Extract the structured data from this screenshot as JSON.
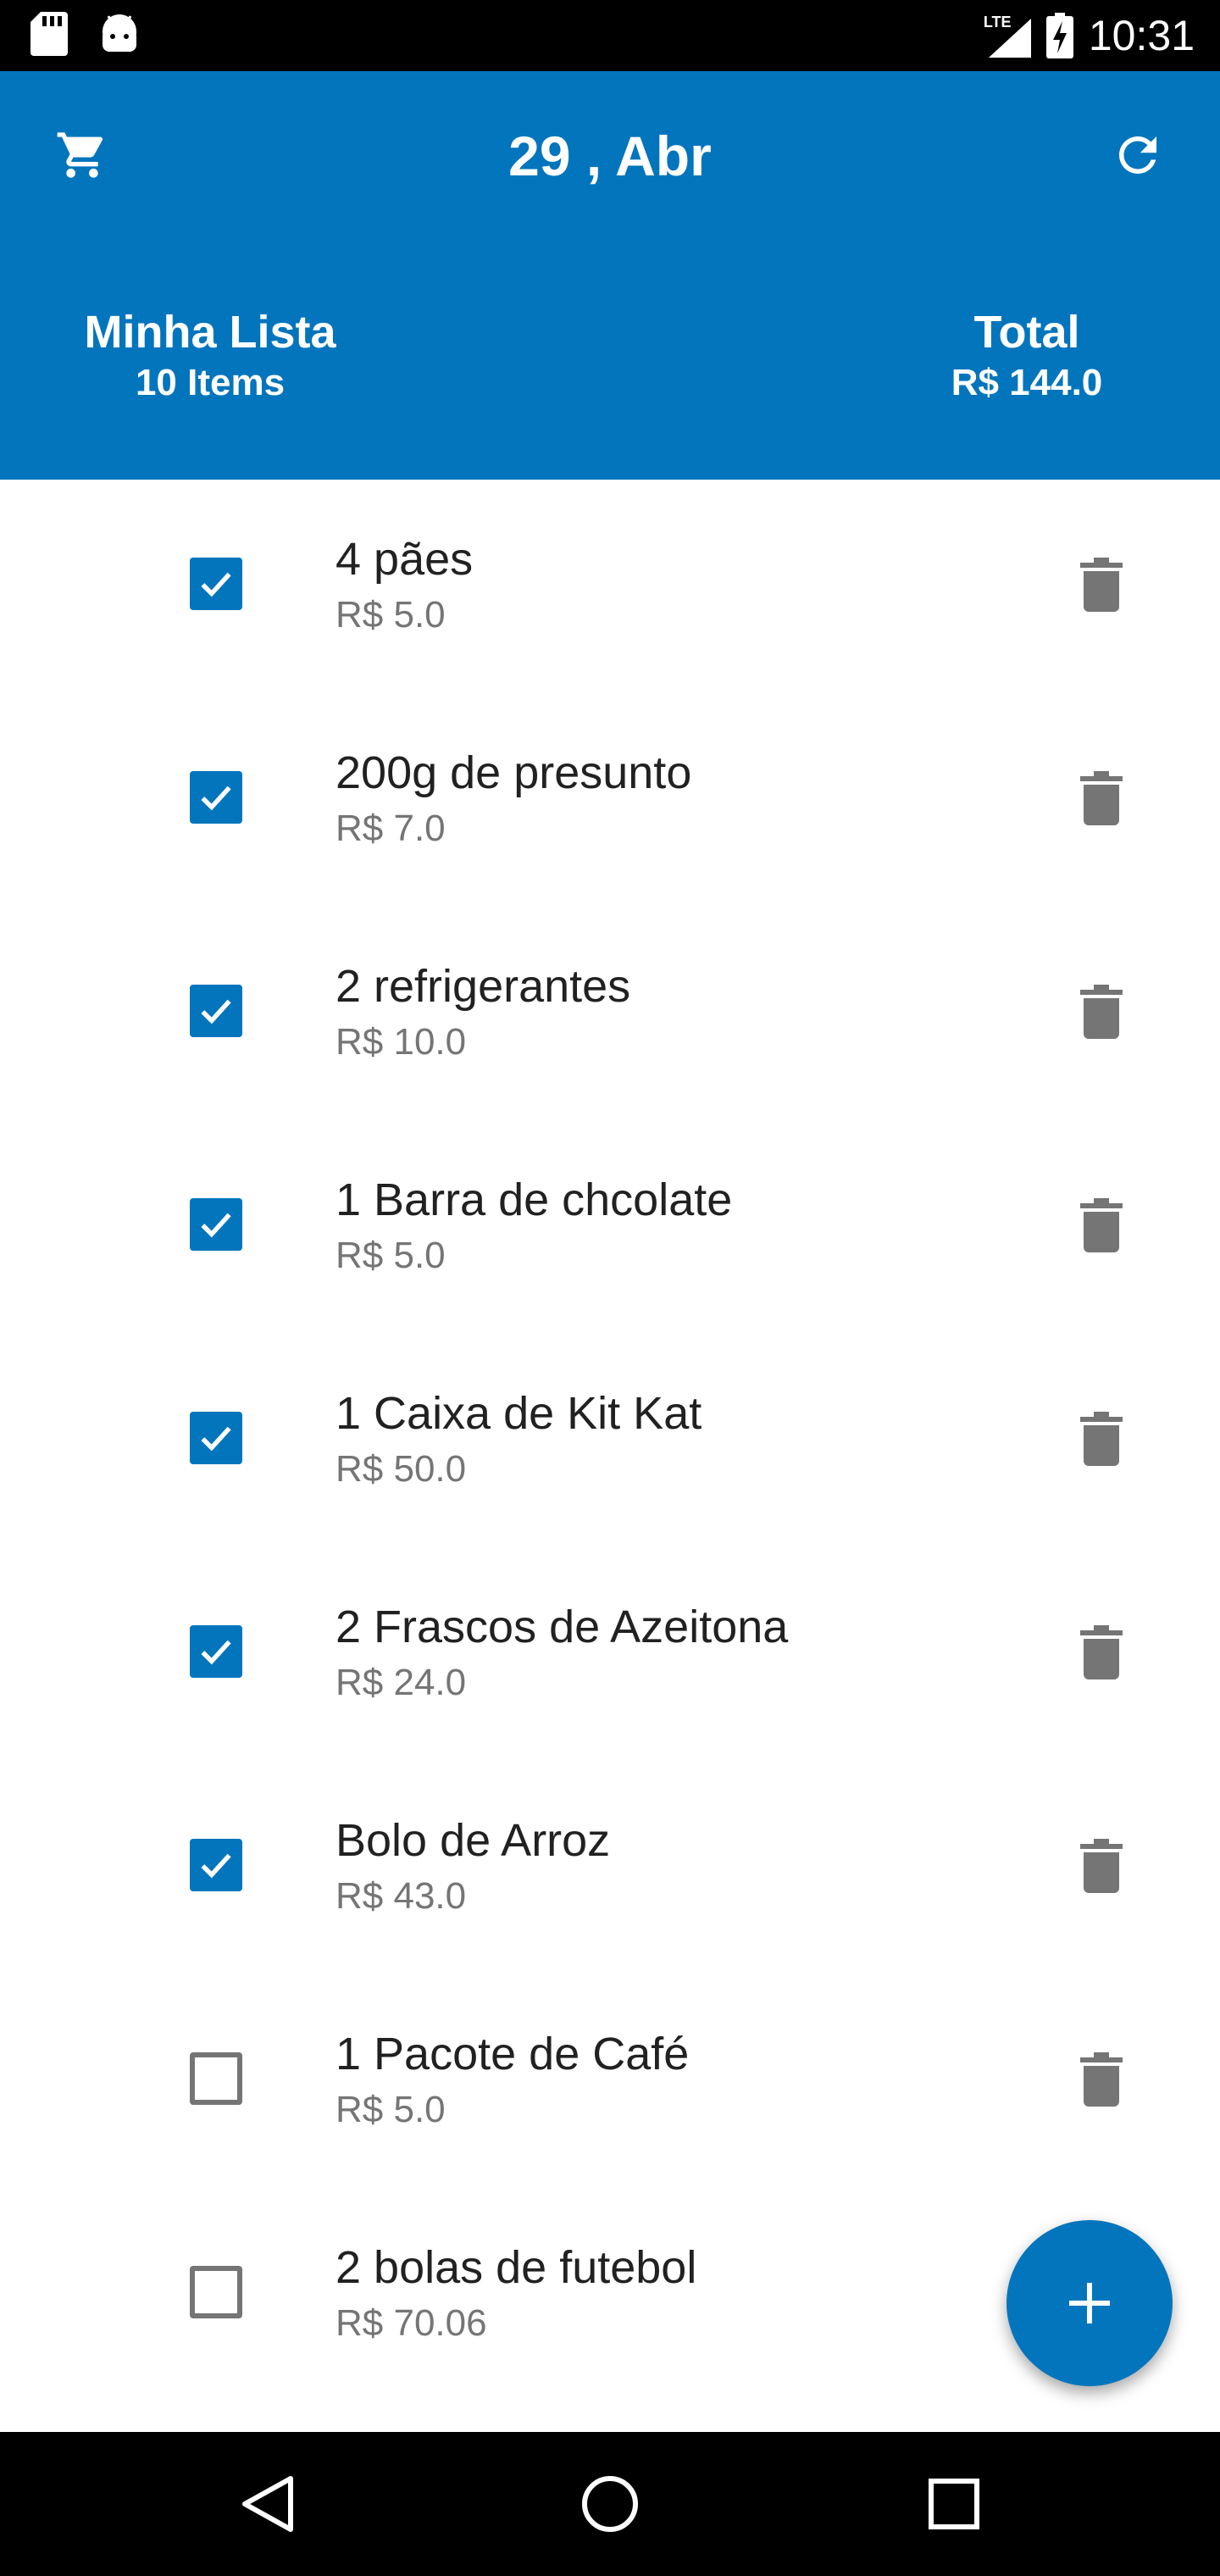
{
  "status_bar": {
    "network": "LTE",
    "time": "10:31"
  },
  "app_bar": {
    "title": "29 , Abr",
    "left_icon": "cart-icon",
    "right_icon": "refresh-icon",
    "color": "#0375bd"
  },
  "summary": {
    "list_title": "Minha Lista",
    "list_count": "10 Items",
    "total_title": "Total",
    "total_value": "R$ 144.0"
  },
  "items": [
    {
      "name": "4 pães",
      "price": "R$ 5.0",
      "checked": true
    },
    {
      "name": "200g de presunto",
      "price": "R$ 7.0",
      "checked": true
    },
    {
      "name": "2 refrigerantes",
      "price": "R$ 10.0",
      "checked": true
    },
    {
      "name": "1 Barra de chcolate",
      "price": "R$ 5.0",
      "checked": true
    },
    {
      "name": "1 Caixa de Kit Kat",
      "price": "R$ 50.0",
      "checked": true
    },
    {
      "name": "2 Frascos de Azeitona",
      "price": "R$ 24.0",
      "checked": true
    },
    {
      "name": "Bolo de Arroz",
      "price": "R$ 43.0",
      "checked": true
    },
    {
      "name": "1 Pacote de Café",
      "price": "R$ 5.0",
      "checked": false
    },
    {
      "name": "2 bolas de futebol",
      "price": "R$ 70.06",
      "checked": false
    }
  ],
  "fab": {
    "icon": "plus-icon"
  },
  "colors": {
    "accent": "#0375bd",
    "delete_icon": "#757575"
  }
}
